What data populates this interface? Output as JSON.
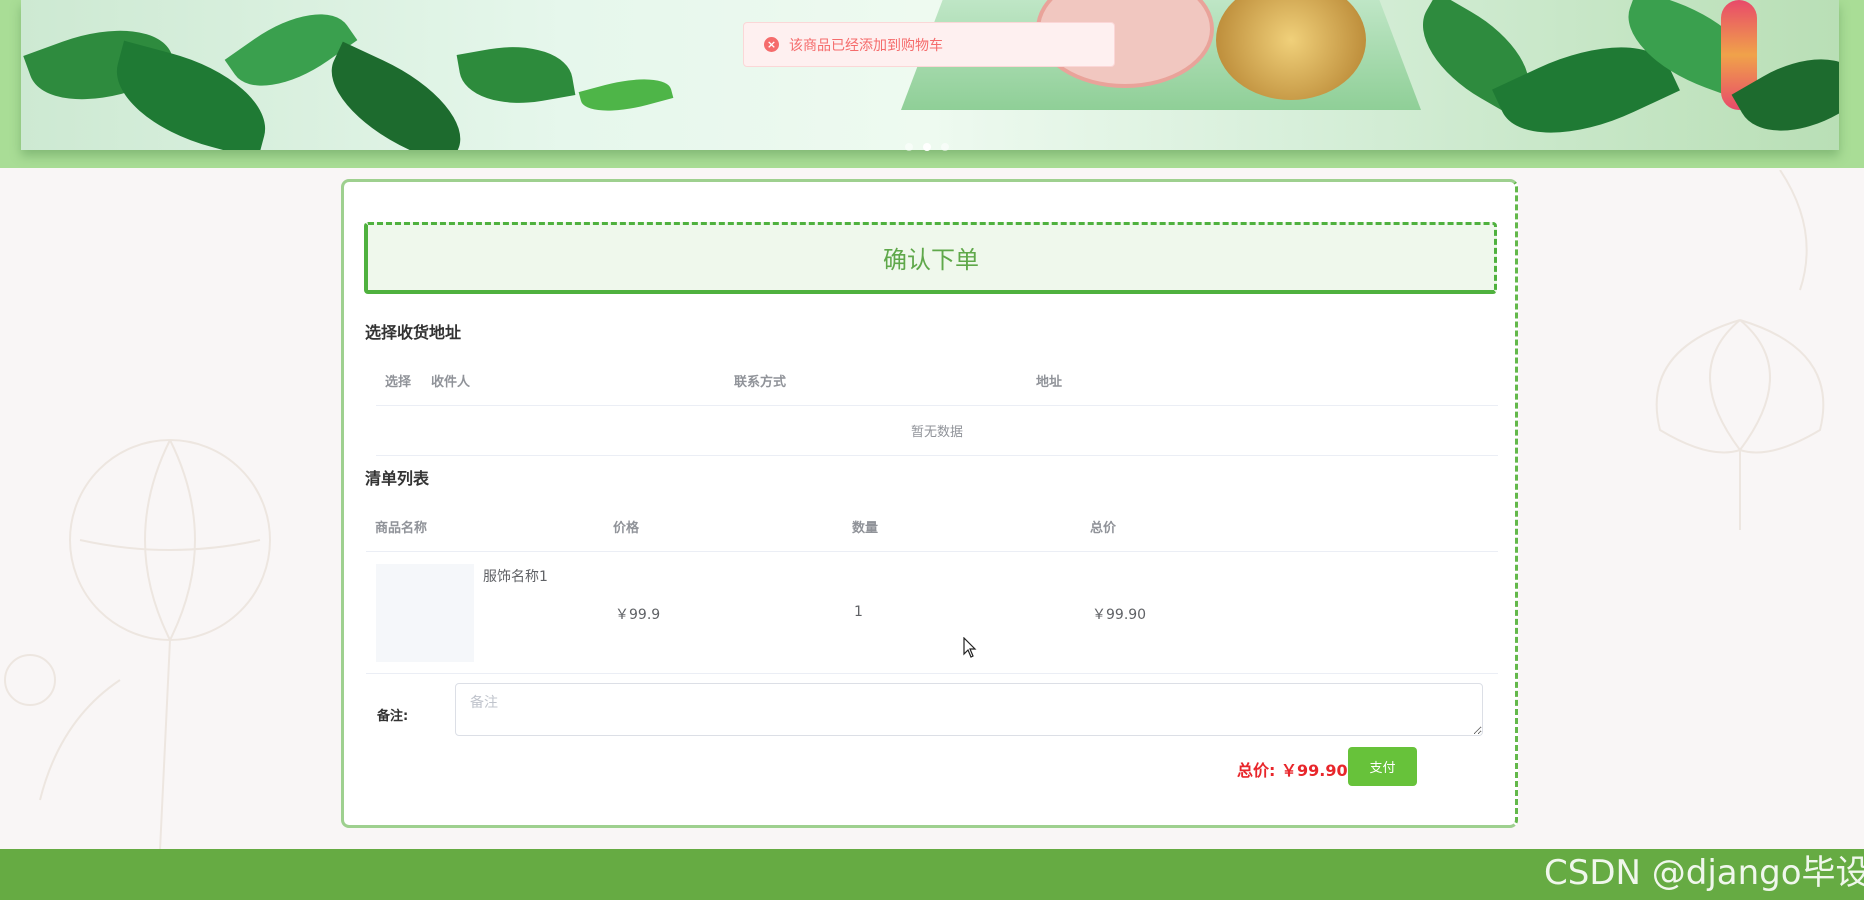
{
  "toast": {
    "message": "该商品已经添加到购物车",
    "icon": "error-circle-icon"
  },
  "banner": {
    "slides": 3,
    "active_slide": 2
  },
  "page_title": "确认下单",
  "address_section": {
    "title": "选择收货地址",
    "columns": [
      "选择",
      "收件人",
      "联系方式",
      "地址"
    ],
    "empty_text": "暂无数据"
  },
  "order_section": {
    "title": "清单列表",
    "columns": [
      "商品名称",
      "价格",
      "数量",
      "总价"
    ],
    "items": [
      {
        "name": "服饰名称1",
        "price": "￥99.9",
        "quantity": "1",
        "subtotal": "￥99.90"
      }
    ]
  },
  "note": {
    "label": "备注:",
    "placeholder": "备注",
    "value": ""
  },
  "summary": {
    "total_label": "总价:",
    "total_value": "￥99.90"
  },
  "actions": {
    "pay_label": "支付"
  },
  "watermark": "CSDN @django毕设",
  "colors": {
    "accent": "#67c23a",
    "price": "#e8262b",
    "footer": "#66ab43",
    "toast_error": "#f56c6c"
  }
}
